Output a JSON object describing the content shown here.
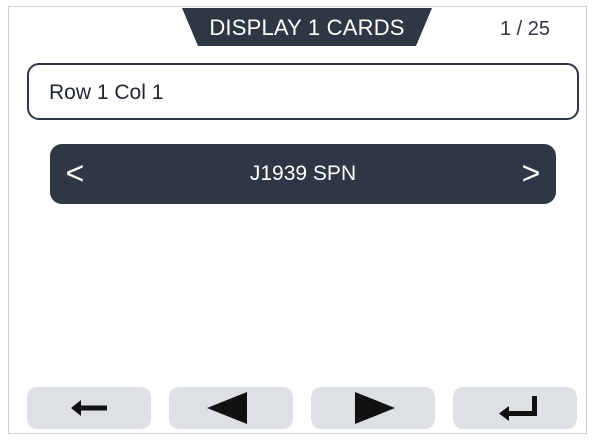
{
  "header": {
    "title": "DISPLAY 1 CARDS",
    "page_counter": "1 / 25"
  },
  "field": {
    "value": "Row 1 Col 1"
  },
  "selector": {
    "prev_label": "<",
    "label": "J1939 SPN",
    "next_label": ">"
  },
  "footer": {
    "buttons": [
      {
        "icon": "back-arrow-icon"
      },
      {
        "icon": "previous-triangle-icon"
      },
      {
        "icon": "next-triangle-icon"
      },
      {
        "icon": "enter-icon"
      }
    ]
  },
  "colors": {
    "dark": "#2f3744",
    "button_bg": "#dde1e6",
    "text_on_dark": "#ffffff"
  }
}
